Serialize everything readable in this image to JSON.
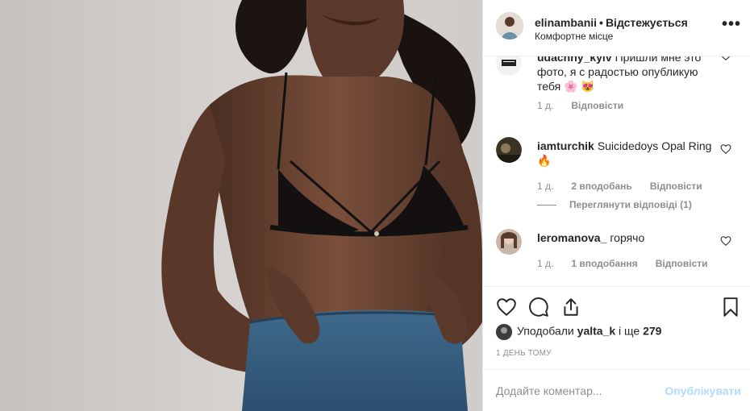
{
  "post": {
    "photo_icon": "photo-of-woman-in-black-bralette-and-jeans"
  },
  "header": {
    "username": "elinambanii",
    "separator": "•",
    "follow_status": "Відстежується",
    "location": "Комфортне місце",
    "more_icon": "more-options-icon",
    "more_glyph": "•••"
  },
  "comments": [
    {
      "username": "udachny_kyiv",
      "text": "Пришли мне это фото, я с радостью опубликую тебя 🌸 😻",
      "time": "1 д.",
      "likes": "",
      "reply_label": "Відповісти"
    },
    {
      "username": "iamturchik",
      "text": "Suicidedoys Opal Ring 🔥",
      "time": "1 д.",
      "likes": "2 вподобань",
      "reply_label": "Відповісти",
      "view_replies": "Переглянути відповіді (1)"
    },
    {
      "username": "leromanova_",
      "text": "горячо",
      "time": "1 д.",
      "likes": "1 вподобання",
      "reply_label": "Відповісти"
    }
  ],
  "actions": {
    "like_icon": "heart-icon",
    "comment_icon": "comment-icon",
    "share_icon": "share-icon",
    "save_icon": "bookmark-icon"
  },
  "likes": {
    "prefix": "Уподобали",
    "user": "yalta_k",
    "connector": "і ще",
    "count": "279"
  },
  "timestamp": "1 ДЕНЬ ТОМУ",
  "add_comment": {
    "placeholder": "Додайте коментар...",
    "publish_label": "Опублікувати"
  },
  "colors": {
    "text": "#262626",
    "muted": "#8e8e8e",
    "publish_disabled": "#b3dbff",
    "border": "#efefef"
  }
}
